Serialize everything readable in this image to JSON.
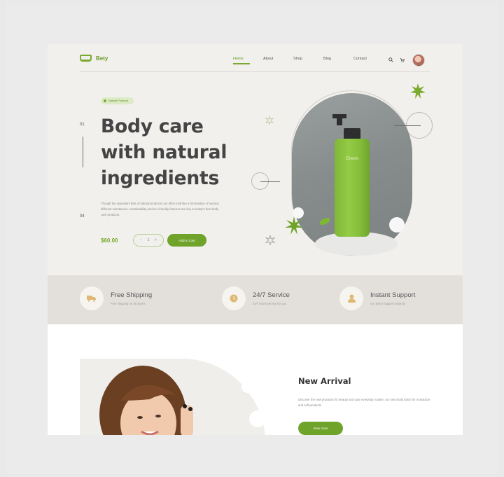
{
  "brand": {
    "name": "Bety"
  },
  "nav": {
    "links": [
      "Home",
      "About",
      "Shop",
      "Blog",
      "Contact"
    ],
    "icons": [
      "search-icon",
      "cart-icon"
    ]
  },
  "hero": {
    "badge": "Natural Products",
    "slide_start": "01",
    "slide_end": "04",
    "headline_1": "Body care",
    "headline_2": "with natural",
    "headline_3": "ingredients",
    "description": "Though the ingredient lists of natural products can often look like a formulation of various different substances, sustainability and eco-friendly features are key to today's best body care products.",
    "price": "$60.00",
    "qty_minus": "−",
    "qty_value": "1",
    "qty_plus": "+",
    "add_to_cart": "Add to Cart",
    "product_label": "Green"
  },
  "features": [
    {
      "title": "Free Shipping",
      "desc": "Free shipping on all orders",
      "icon": "truck-icon"
    },
    {
      "title": "24/7 Service",
      "desc": "24/7 hours service for you",
      "icon": "clock-icon"
    },
    {
      "title": "Instant Support",
      "desc": "Get direct support instantly",
      "icon": "support-icon"
    }
  ],
  "arrival": {
    "heading": "New Arrival",
    "description": "Discover the new products for beauty and your everyday routine, our new body lotion for moisturize and soft products.",
    "button": "View more"
  },
  "colors": {
    "accent": "#6fa32a",
    "hero_bg": "#f2f0ed",
    "strip_bg": "#e3e0dc",
    "feature_icon": "#dfb874"
  }
}
